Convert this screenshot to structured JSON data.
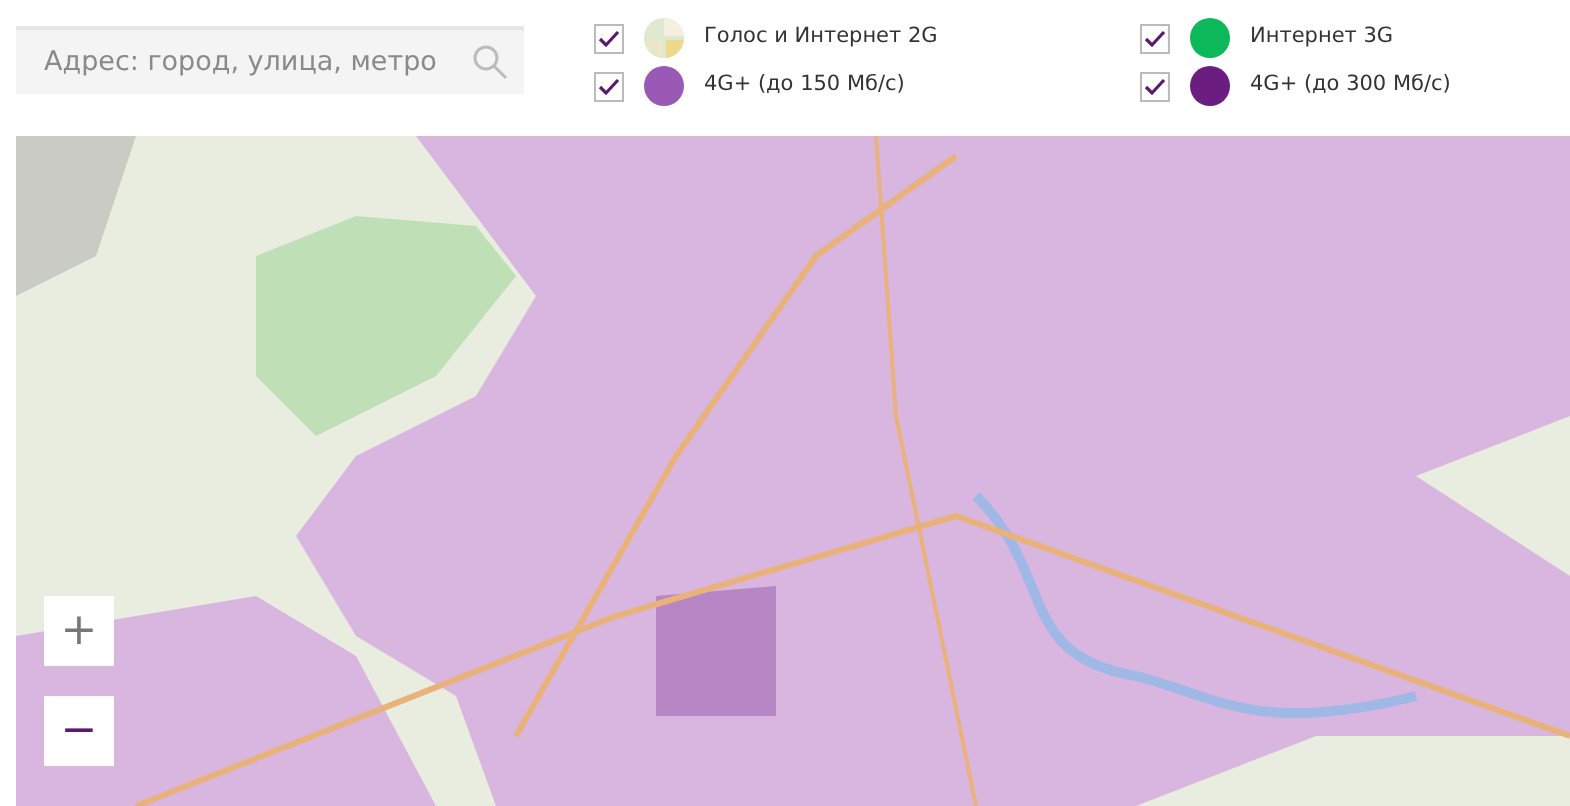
{
  "search": {
    "placeholder": "Адрес: город, улица, метро"
  },
  "legend": [
    {
      "label": "Голос и Интернет 2G",
      "checked": true,
      "kind": "mosaic"
    },
    {
      "label": "Интернет 3G",
      "checked": true,
      "kind": "solid",
      "color": "#0cb85a"
    },
    {
      "label": "4G+ (до 150 Мб/с)",
      "checked": true,
      "kind": "solid",
      "color": "#9b59b6"
    },
    {
      "label": "4G+ (до 300 Мб/с)",
      "checked": true,
      "kind": "solid",
      "color": "#6b1d80"
    }
  ],
  "zoom_controls": [
    "+",
    "−"
  ]
}
